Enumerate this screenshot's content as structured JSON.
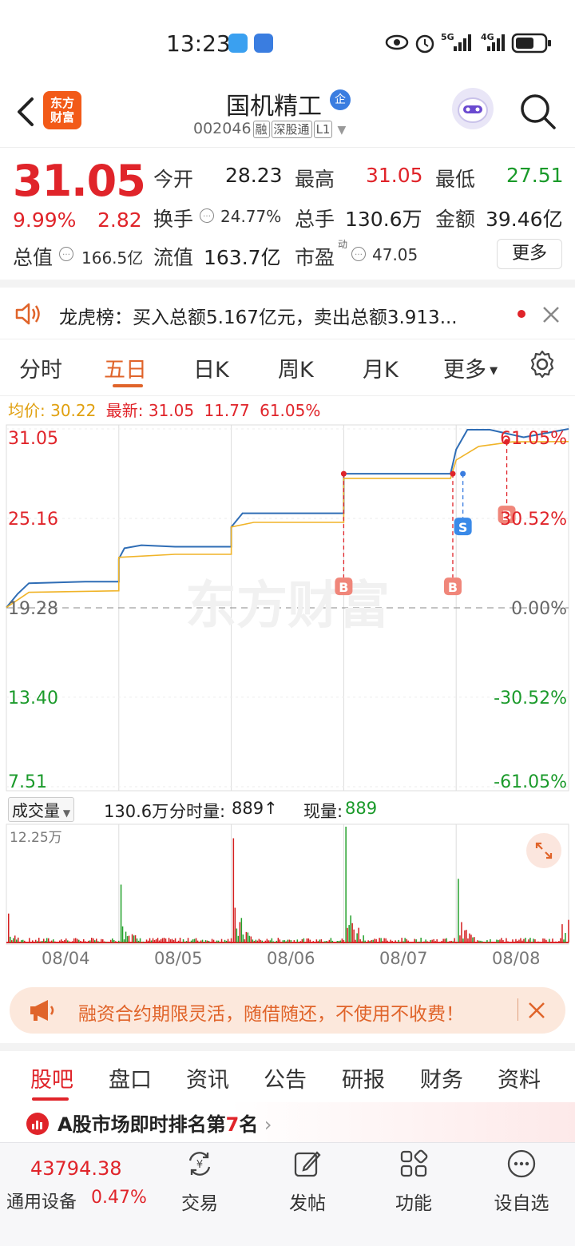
{
  "status": {
    "time": "13:23",
    "net1": "5G",
    "net2": "4G"
  },
  "header": {
    "logo_line1": "东方",
    "logo_line2": "财富",
    "name": "国机精工",
    "ent_badge": "企",
    "code": "002046",
    "tags": [
      "融",
      "深股通",
      "L1"
    ]
  },
  "quote": {
    "price": "31.05",
    "change_pct": "9.99%",
    "change": "2.82",
    "open_label": "今开",
    "open": "28.23",
    "high_label": "最高",
    "high": "31.05",
    "low_label": "最低",
    "low": "27.51",
    "turnover_label": "换手",
    "turnover": "24.77%",
    "volume_label": "总手",
    "volume": "130.6万",
    "amount_label": "金额",
    "amount": "39.46亿",
    "mktcap_label": "总值",
    "mktcap": "166.5亿",
    "float_label": "流值",
    "float": "163.7亿",
    "pe_label": "市盈",
    "pe_sup": "动",
    "pe": "47.05",
    "more": "更多"
  },
  "notice": {
    "text": "龙虎榜：买入总额5.167亿元，卖出总额3.913..."
  },
  "chart_tabs": [
    "分时",
    "五日",
    "日K",
    "周K",
    "月K",
    "更多"
  ],
  "price_line": {
    "avg_label": "均价:",
    "avg": "30.22",
    "latest_label": "最新:",
    "latest": "31.05",
    "change": "11.77",
    "pct": "61.05%"
  },
  "chart_data": {
    "type": "line",
    "x": [
      "08/04",
      "08/05",
      "08/06",
      "08/07",
      "08/08"
    ],
    "y_left_ticks": [
      "31.05",
      "25.16",
      "19.28",
      "13.40",
      "7.51"
    ],
    "y_right_ticks": [
      "61.05%",
      "30.52%",
      "0.00%",
      "-30.52%",
      "-61.05%"
    ],
    "ylim": [
      7.51,
      31.05
    ],
    "base": 19.28,
    "series": [
      {
        "color": "#2f6db5",
        "values": [
          [
            0.0,
            19.3
          ],
          [
            0.1,
            20.2
          ],
          [
            0.2,
            20.9
          ],
          [
            0.7,
            21.0
          ],
          [
            1.0,
            21.0
          ],
          [
            1.0,
            22.5
          ],
          [
            1.05,
            23.2
          ],
          [
            1.2,
            23.4
          ],
          [
            1.5,
            23.3
          ],
          [
            2.0,
            23.3
          ],
          [
            2.0,
            24.6
          ],
          [
            2.1,
            25.5
          ],
          [
            2.5,
            25.5
          ],
          [
            3.0,
            25.5
          ],
          [
            3.0,
            28.1
          ],
          [
            3.5,
            28.1
          ],
          [
            3.95,
            28.1
          ],
          [
            4.0,
            29.7
          ],
          [
            4.1,
            31.0
          ],
          [
            4.3,
            31.0
          ],
          [
            4.6,
            30.5
          ],
          [
            5.0,
            31.05
          ]
        ]
      },
      {
        "color": "#f0b429",
        "values": [
          [
            0.0,
            19.3
          ],
          [
            0.1,
            19.8
          ],
          [
            0.2,
            20.3
          ],
          [
            1.0,
            20.4
          ],
          [
            1.0,
            22.6
          ],
          [
            1.5,
            22.8
          ],
          [
            2.0,
            22.8
          ],
          [
            2.0,
            24.6
          ],
          [
            2.2,
            24.9
          ],
          [
            3.0,
            24.9
          ],
          [
            3.0,
            27.8
          ],
          [
            3.95,
            27.8
          ],
          [
            4.0,
            29.0
          ],
          [
            4.2,
            29.9
          ],
          [
            4.5,
            30.2
          ],
          [
            5.0,
            30.22
          ]
        ]
      }
    ],
    "markers": [
      "B",
      "B",
      "S",
      "B"
    ],
    "watermark": "东方财富"
  },
  "volume": {
    "label": "成交量",
    "total": "130.6万",
    "tick_label": "分时量:",
    "tick": "889↑",
    "now_label": "现量:",
    "now": "889",
    "max": "12.25万"
  },
  "dates": [
    "08/04",
    "08/05",
    "08/06",
    "08/07",
    "08/08"
  ],
  "promo": {
    "text": "融资合约期限灵活，随借随还，不使用不收费！"
  },
  "bottom_tabs": [
    "股吧",
    "盘口",
    "资讯",
    "公告",
    "研报",
    "财务",
    "资料"
  ],
  "rank": {
    "prefix": "A股市场即时排名第",
    "num": "7",
    "suffix": "名"
  },
  "nav": {
    "index_value": "43794.38",
    "index_name": "通用设备",
    "index_pct": "0.47%",
    "items": [
      "交易",
      "发帖",
      "功能",
      "设自选"
    ]
  },
  "colors": {
    "up": "#e0242a",
    "down": "#1a9a2a",
    "accent": "#e0642a",
    "price_line": "#2f6db5",
    "avg_line": "#f0b429"
  }
}
